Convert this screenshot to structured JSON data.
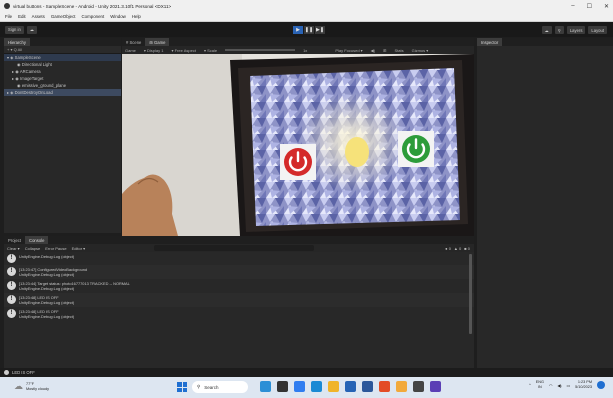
{
  "window": {
    "title": "virtual buttons - SampleScene - Android - Unity 2021.3.10f1 Personal <DX11>",
    "controls": [
      "–",
      "☐",
      "✕"
    ]
  },
  "menu": [
    "File",
    "Edit",
    "Assets",
    "GameObject",
    "Component",
    "Window",
    "Help"
  ],
  "toolbar": {
    "sign_in": "Sign in",
    "right_buttons": [
      "☁",
      "⚲",
      "Layers",
      "Layout"
    ],
    "play": "▶",
    "pause": "❚❚",
    "step": "▶❚"
  },
  "hierarchy": {
    "tab": "Hierarchy",
    "search": "+ ▾  Q All",
    "items": [
      {
        "label": "▾ ◈ SampleScene",
        "indent": 0,
        "kind": "scene"
      },
      {
        "label": "◉ Directional Light",
        "indent": 2,
        "kind": "normal"
      },
      {
        "label": "▸ ◉ ARCamera",
        "indent": 1,
        "kind": "normal"
      },
      {
        "label": "▸ ◉ ImageTarget",
        "indent": 1,
        "kind": "normal"
      },
      {
        "label": "◉ emissive_ground_plane",
        "indent": 2,
        "kind": "normal"
      },
      {
        "label": "▸ ◈ DontDestroyOnLoad",
        "indent": 0,
        "kind": "sel"
      }
    ]
  },
  "scene_tabs": {
    "scene": "# Scene",
    "game": "⊞ Game"
  },
  "game_toolbar": {
    "display": "Game",
    "display_num": "▾ Display 1",
    "aspect": "▾ Free Aspect",
    "scale_label": "▾ Scale",
    "scale_value": "1x",
    "play_mode": "Play Focused ▾",
    "options": [
      "◀)",
      "⊞",
      "Stats",
      "Gizmos ▾"
    ]
  },
  "inspector": {
    "tab": "Inspector"
  },
  "console": {
    "tabs": [
      "Project",
      "Console"
    ],
    "toolbar": [
      "Clear ▾",
      "Collapse",
      "Error Pause",
      "Editor ▾"
    ],
    "counts": [
      "0",
      "0",
      "0"
    ],
    "logs": [
      {
        "line1": "",
        "line2": "UnityEngine.Debug:Log (object)"
      },
      {
        "line1": "[13:23:47] ConfiguredVideoBackground",
        "line2": "UnityEngine.Debug:Log (object)"
      },
      {
        "line1": "[13:23:44] Target status: photo16777013 TRACKED -- NORMAL",
        "line2": "UnityEngine.Debug:Log (object)"
      },
      {
        "line1": "[13:23:48] LED IS OFF",
        "line2": "UnityEngine.Debug:Log (object)"
      },
      {
        "line1": "[13:23:48] LED IS OFF",
        "line2": "UnityEngine.Debug:Log (object)"
      }
    ]
  },
  "status": {
    "message": "LED IS OFF"
  },
  "taskbar": {
    "weather_temp": "77°F",
    "weather_desc": "Mostly cloudy",
    "search": "Search",
    "lang": "ENG",
    "lang2": "IN",
    "time": "1:23 PM",
    "date": "5/10/2023",
    "icons": [
      "file-explorer-icon",
      "media-icon",
      "chrome-icon",
      "edge-icon",
      "folder-icon",
      "store-icon",
      "word-icon",
      "chrome-profile-icon",
      "settings-icon",
      "unity-icon",
      "github-icon"
    ],
    "icon_colors": [
      "#2b8fd6",
      "#333333",
      "#2f7df0",
      "#1a8ad4",
      "#f0b429",
      "#2563b5",
      "#2b579a",
      "#e34c26",
      "#f2a93b",
      "#444444",
      "#5b3fb5"
    ]
  },
  "colors": {
    "accent": "#2a63b4",
    "power_off": "#d42a2a",
    "power_on": "#2d9c3a"
  }
}
